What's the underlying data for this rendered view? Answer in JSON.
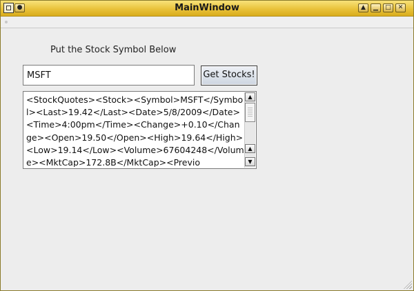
{
  "window": {
    "title": "MainWindow",
    "buttons": {
      "shade_glyph": "▲",
      "minimize_glyph": "▁",
      "maximize_glyph": "□",
      "close_glyph": "✕"
    }
  },
  "form": {
    "prompt_label": "Put the Stock Symbol Below",
    "symbol_value": "MSFT",
    "get_button_label": "Get Stocks!"
  },
  "output": {
    "text": "<StockQuotes><Stock><Symbol>MSFT</Symbol><Last>19.42</Last><Date>5/8/2009</Date><Time>4:00pm</Time><Change>+0.10</Change><Open>19.50</Open><High>19.64</High><Low>19.14</Low><Volume>67604248</Volume><MktCap>172.8B</MktCap><Previo"
  },
  "scrollbar": {
    "up_glyph": "▲",
    "down_glyph": "▼"
  }
}
